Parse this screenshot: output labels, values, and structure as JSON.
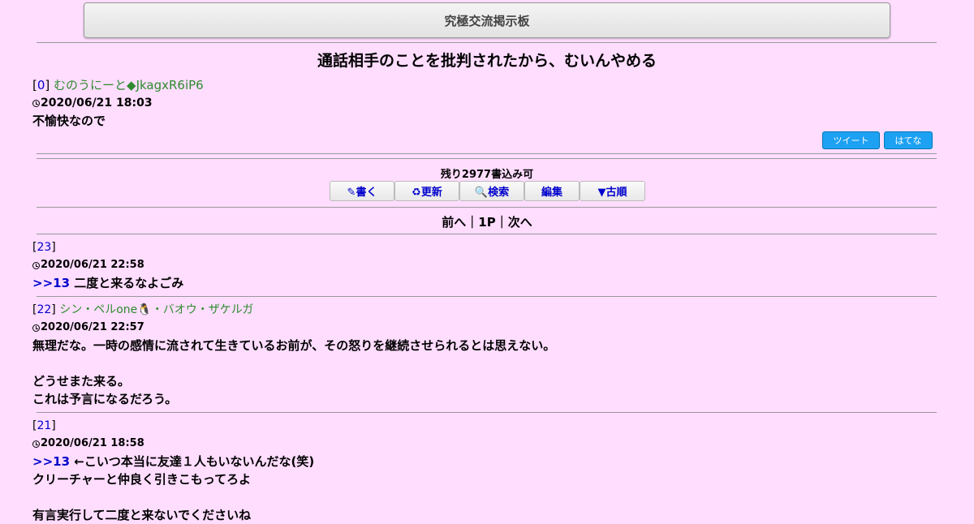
{
  "board_title": "究極交流掲示板",
  "thread": {
    "title": "通話相手のことを批判されたから、むいんやめる",
    "op": {
      "num": "0",
      "author": "むのうにーと◆JkagxR6iP6",
      "date": "2020/06/21 18:03",
      "body": "不愉快なので"
    }
  },
  "share": {
    "tweet": "ツイート",
    "hatena": "はてな"
  },
  "remaining": "残り2977書込み可",
  "nav_buttons": {
    "write": "✎書く",
    "refresh": "♻更新",
    "search": "🔍検索",
    "edit": "編集",
    "old": "▼古順"
  },
  "pager": {
    "prev": "前へ",
    "page": "1P",
    "next": "次へ",
    "sep": "｜"
  },
  "posts": [
    {
      "num": "23",
      "author": "",
      "date": "2020/06/21 22:58",
      "anchor": ">>13",
      "lines": [
        "二度と来るなよごみ"
      ]
    },
    {
      "num": "22",
      "author": "シン・ペルone🐧・バオウ・ザケルガ",
      "date": "2020/06/21 22:57",
      "anchor": "",
      "lines": [
        "無理だな。一時の感情に流されて生きているお前が、その怒りを継続させられるとは思えない。",
        "",
        "どうせまた来る。",
        "これは予言になるだろう。"
      ]
    },
    {
      "num": "21",
      "author": "",
      "date": "2020/06/21 18:58",
      "anchor": ">>13",
      "lines": [
        "←こいつ本当に友達１人もいないんだな(笑)",
        "クリーチャーと仲良く引きこもってろよ",
        "",
        "有言実行して二度と来ないでくださいね"
      ]
    }
  ]
}
